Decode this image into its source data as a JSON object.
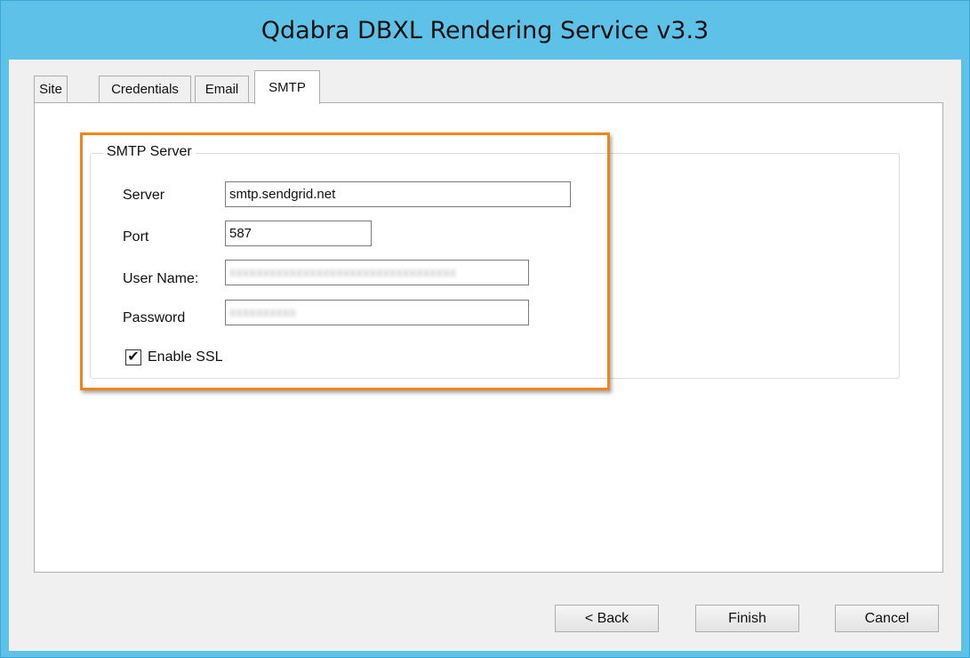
{
  "window": {
    "title": "Qdabra DBXL Rendering Service v3.3"
  },
  "tabs": [
    {
      "label": "Site",
      "active": false
    },
    {
      "label": "Credentials",
      "active": false
    },
    {
      "label": "Email",
      "active": false
    },
    {
      "label": "SMTP",
      "active": true
    }
  ],
  "smtp": {
    "group_title": "SMTP Server",
    "server_label": "Server",
    "server_value": "smtp.sendgrid.net",
    "port_label": "Port",
    "port_value": "587",
    "username_label": "User Name:",
    "username_value": "xxxxxxxxxxxxxxxxxxxxxxxxxxxxxxxxxx",
    "password_label": "Password",
    "password_value": "xxxxxxxxxx",
    "ssl_label": "Enable SSL",
    "ssl_checked": true
  },
  "buttons": {
    "back": "< Back",
    "finish": "Finish",
    "cancel": "Cancel"
  },
  "colors": {
    "window_border": "#5ec1e8",
    "highlight": "#f0861a"
  }
}
